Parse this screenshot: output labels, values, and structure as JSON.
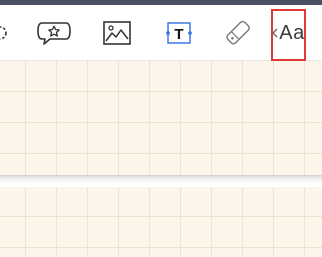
{
  "toolbar": {
    "tools": [
      {
        "icon": "lasso-icon"
      },
      {
        "icon": "sticker-icon"
      },
      {
        "icon": "image-icon"
      },
      {
        "icon": "text-box-icon",
        "selected": true
      },
      {
        "icon": "eraser-icon"
      }
    ],
    "font_button": {
      "label": "Aa",
      "icon": "font-style-icon",
      "highlighted": true
    }
  },
  "canvas": {
    "background": "#fbf6e9",
    "grid_color": "#e9e3cf",
    "pattern": "grid"
  },
  "colors": {
    "accent": "#2f6fe0",
    "highlight": "#e0393a",
    "top_strip": "#4a4f63"
  }
}
